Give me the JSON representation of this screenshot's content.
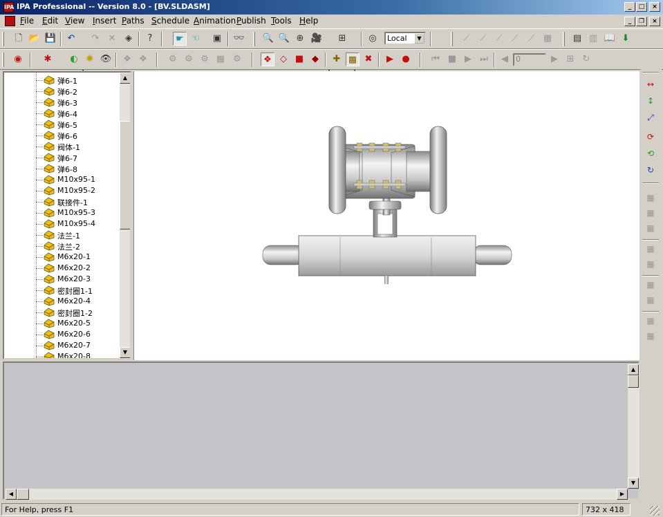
{
  "window": {
    "title": "IPA Professional -- Version 8.0 - [BV.SLDASM]"
  },
  "menu": [
    {
      "label": "File",
      "u": "F",
      "rest": "ile"
    },
    {
      "label": "Edit",
      "u": "E",
      "rest": "dit"
    },
    {
      "label": "View",
      "u": "V",
      "rest": "iew"
    },
    {
      "label": "Insert",
      "u": "I",
      "rest": "nsert"
    },
    {
      "label": "Paths",
      "u": "P",
      "rest": "aths"
    },
    {
      "label": "Schedule",
      "u": "S",
      "rest": "chedule"
    },
    {
      "label": "Animation",
      "u": "A",
      "rest": "nimation"
    },
    {
      "label": "Publish",
      "u": "P",
      "rest": "ublish"
    },
    {
      "label": "Tools",
      "u": "T",
      "rest": "ools"
    },
    {
      "label": "Help",
      "u": "H",
      "rest": "elp"
    }
  ],
  "toolbar": {
    "coord_system": "Local",
    "frame_value": "0"
  },
  "tree": {
    "items": [
      "弹6-1",
      "弹6-2",
      "弹6-3",
      "弹6-4",
      "弹6-5",
      "弹6-6",
      "阀体-1",
      "弹6-7",
      "弹6-8",
      "M10x95-1",
      "M10x95-2",
      "联接件-1",
      "M10x95-3",
      "M10x95-4",
      "法兰-1",
      "法兰-2",
      "M6x20-1",
      "M6x20-2",
      "M6x20-3",
      "密封圈1-1",
      "M6x20-4",
      "密封圈1-2",
      "M6x20-5",
      "M6x20-6",
      "M6x20-7",
      "M6x20-8"
    ]
  },
  "status": {
    "help_text": "For Help, press F1",
    "dimensions": "732 x 418"
  },
  "colors": {
    "title_start": "#0a246a",
    "title_end": "#a6caf0",
    "chrome": "#d4d0c8",
    "lower_panel": "#c4c3c8",
    "part_icon": "#e8c020"
  }
}
